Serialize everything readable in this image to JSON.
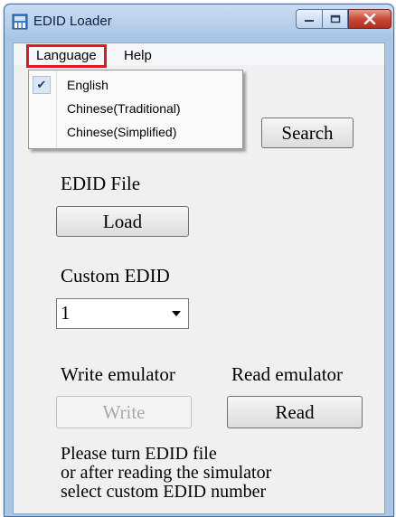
{
  "window": {
    "title": "EDID Loader"
  },
  "menubar": {
    "items": [
      {
        "label": "Language"
      },
      {
        "label": "Help"
      }
    ]
  },
  "language_menu": {
    "items": [
      {
        "label": "English",
        "checked": true
      },
      {
        "label": "Chinese(Traditional)",
        "checked": false
      },
      {
        "label": "Chinese(Simplified)",
        "checked": false
      }
    ]
  },
  "search": {
    "label": "Search"
  },
  "edid_file": {
    "heading": "EDID File",
    "load_label": "Load"
  },
  "custom_edid": {
    "heading": "Custom EDID",
    "selected": "1"
  },
  "emulator": {
    "write_heading": "Write emulator",
    "read_heading": "Read emulator",
    "write_label": "Write",
    "read_label": "Read",
    "write_enabled": false
  },
  "hint_lines": [
    "Please turn EDID file",
    "or after reading the simulator",
    "select custom EDID number"
  ],
  "colors": {
    "highlight_border": "#e0191f",
    "title_bar": "#b9d1ea",
    "close_button": "#c84432"
  }
}
